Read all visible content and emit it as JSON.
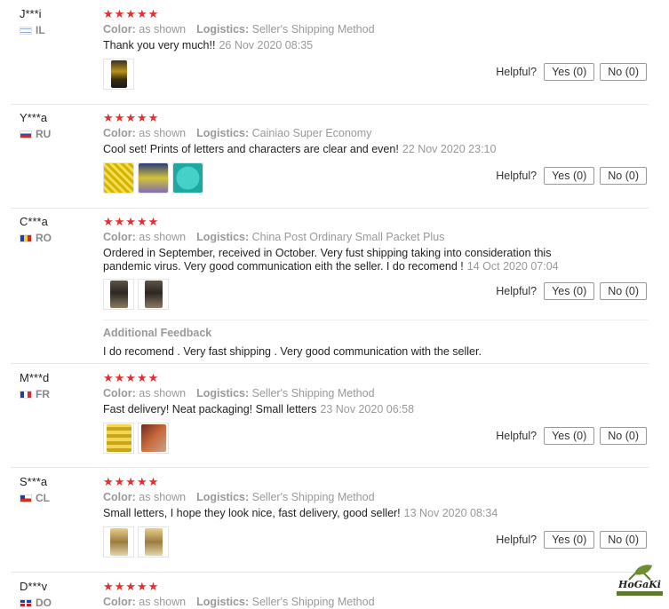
{
  "labels": {
    "color": "Color:",
    "logistics": "Logistics:",
    "helpful": "Helpful?",
    "yes": "Yes (0)",
    "no": "No (0)",
    "stars": "★★★★★"
  },
  "reviews": [
    {
      "user": "J***i",
      "country": "IL",
      "color": "as shown",
      "logistics": "Seller's Shipping Method",
      "text": "Thank you very much!!",
      "date": "26 Nov 2020 08:35",
      "images": [
        "phone-photo"
      ]
    },
    {
      "user": "Y***a",
      "country": "RU",
      "color": "as shown",
      "logistics": "Cainiao Super Economy",
      "text": "Cool set! Prints of letters and characters are clear and even!",
      "date": "22 Nov 2020 23:10",
      "images": [
        "yellow-beads-photo",
        "package-photo",
        "teal-mat-photo"
      ]
    },
    {
      "user": "C***a",
      "country": "RO",
      "color": "as shown",
      "logistics": "China Post Ordinary Small Packet Plus",
      "text": "Ordered in September, received in October. Very fust shipping taking into consideration this pandemic virus. Very good communication eith the seller. I do recomend !",
      "date": "14 Oct 2020 07:04",
      "images": [
        "dark-photo",
        "dark-photo"
      ],
      "additional_title": "Additional Feedback",
      "additional_text": "I do recomend . Very fast shipping . Very good communication with the seller."
    },
    {
      "user": "M***d",
      "country": "FR",
      "color": "as shown",
      "logistics": "Seller's Shipping Method",
      "text": "Fast delivery! Neat packaging! Small letters",
      "date": "23 Nov 2020 06:58",
      "images": [
        "coins-photo",
        "hand-photo"
      ]
    },
    {
      "user": "S***a",
      "country": "CL",
      "color": "as shown",
      "logistics": "Seller's Shipping Method",
      "text": "Small letters, I hope they look nice, fast delivery, good seller!",
      "date": "13 Nov 2020 08:34",
      "images": [
        "gold-photo",
        "gold-photo"
      ]
    },
    {
      "user": "D***v",
      "country": "DO",
      "color": "as shown",
      "logistics": "Seller's Shipping Method"
    }
  ],
  "logo": {
    "text": "HoGaKi"
  }
}
